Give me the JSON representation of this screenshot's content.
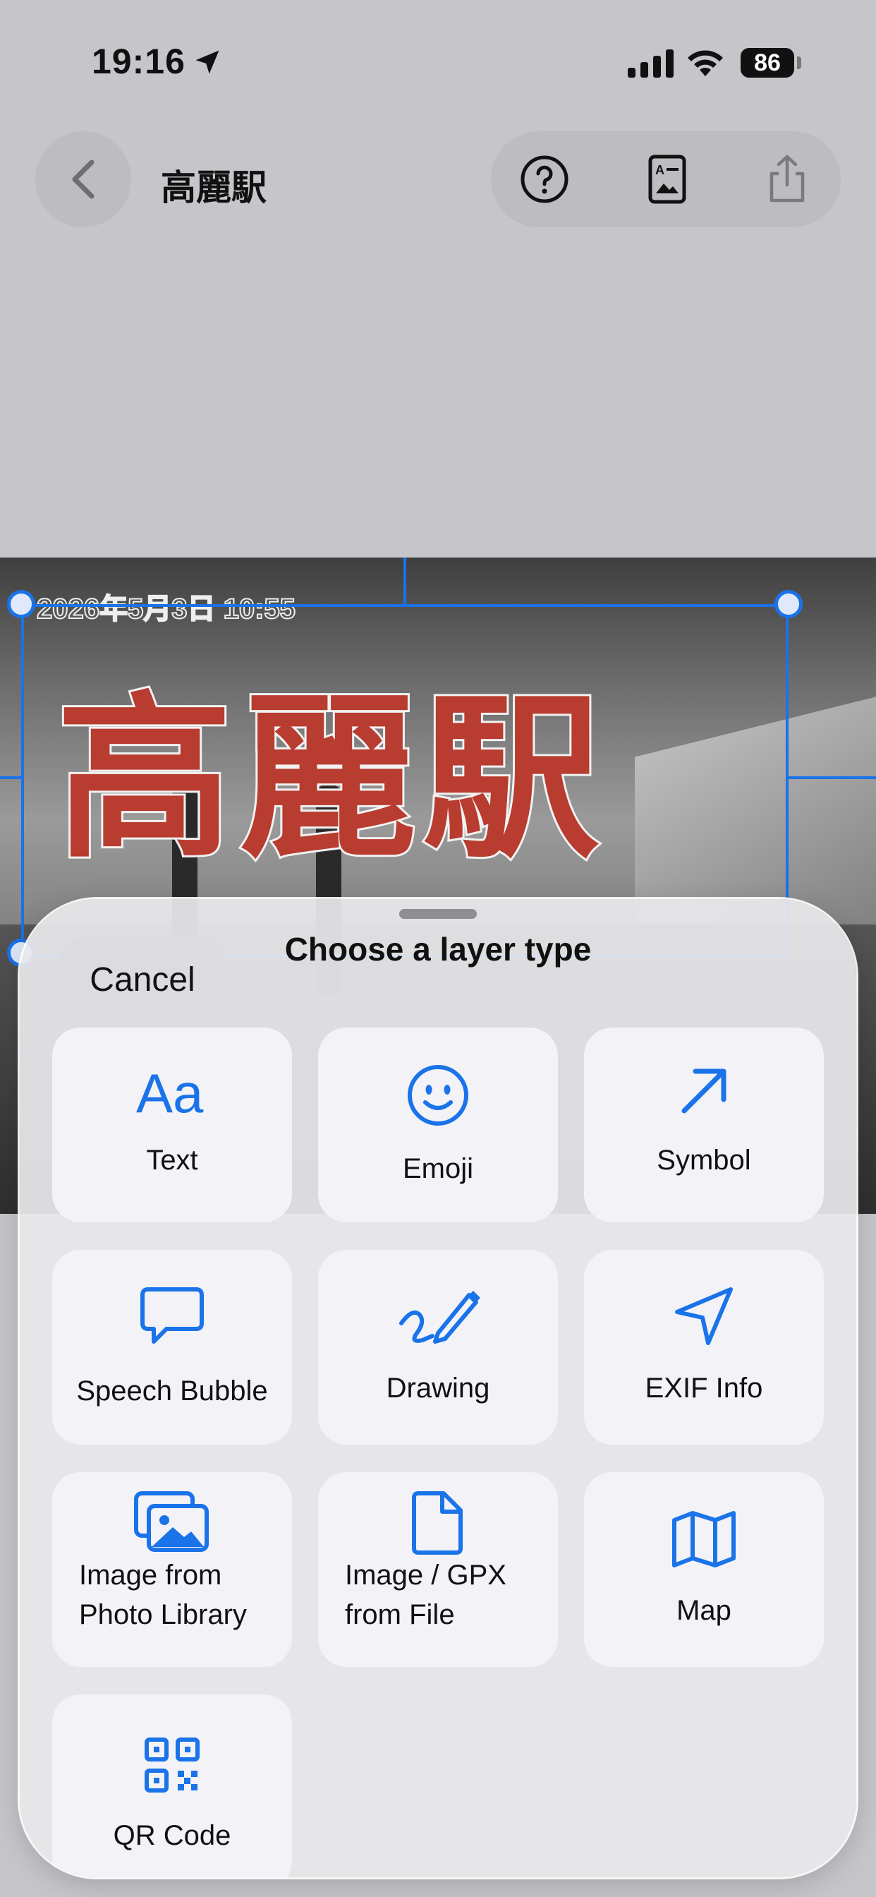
{
  "status_bar": {
    "time": "19:16",
    "battery": "86"
  },
  "nav": {
    "title": "高麗駅"
  },
  "canvas": {
    "date_stamp": "2026年5月3日 10:55",
    "big_title": "高麗駅"
  },
  "sheet": {
    "title": "Choose a layer type",
    "cancel": "Cancel",
    "options": [
      {
        "label": "Text",
        "icon": "text-aa-icon"
      },
      {
        "label": "Emoji",
        "icon": "smiley-icon"
      },
      {
        "label": "Symbol",
        "icon": "arrow-up-right-icon"
      },
      {
        "label": "Speech Bubble",
        "icon": "speech-bubble-icon"
      },
      {
        "label": "Drawing",
        "icon": "pencil-scribble-icon"
      },
      {
        "label": "EXIF Info",
        "icon": "location-arrow-icon"
      },
      {
        "label": "Image from\nPhoto Library",
        "icon": "photos-icon"
      },
      {
        "label": "Image / GPX\nfrom File",
        "icon": "document-icon"
      },
      {
        "label": "Map",
        "icon": "map-icon"
      },
      {
        "label": "QR Code",
        "icon": "qrcode-icon"
      }
    ]
  },
  "colors": {
    "accent": "#1a73e8",
    "title_red": "#b83c2f"
  }
}
